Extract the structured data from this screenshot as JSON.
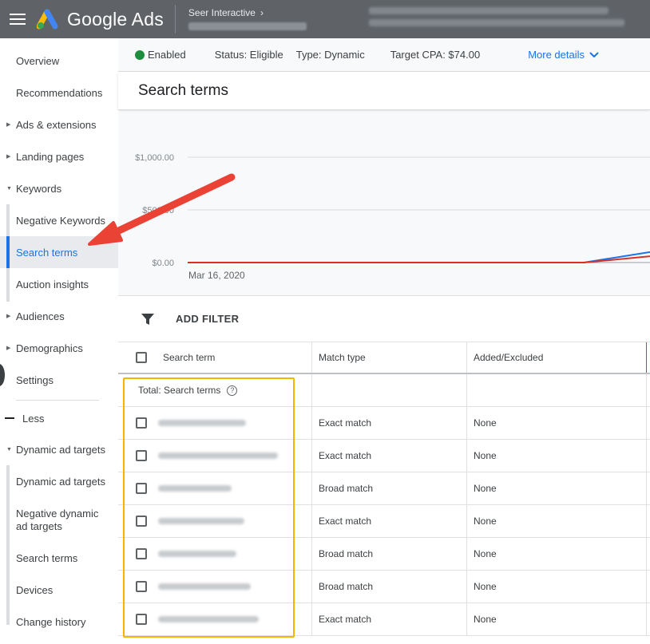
{
  "header": {
    "app_name": "Google Ads",
    "account_name": "Seer Interactive",
    "icons": [
      "menu-icon",
      "google-ads-logo",
      "chevron-right-icon"
    ]
  },
  "sidebar": {
    "items": [
      {
        "label": "Overview"
      },
      {
        "label": "Recommendations"
      },
      {
        "label": "Ads & extensions"
      },
      {
        "label": "Landing pages"
      },
      {
        "label": "Keywords"
      },
      {
        "label": "Negative Keywords"
      },
      {
        "label": "Search terms"
      },
      {
        "label": "Auction insights"
      },
      {
        "label": "Audiences"
      },
      {
        "label": "Demographics"
      },
      {
        "label": "Settings"
      },
      {
        "label": "Less"
      },
      {
        "label": "Dynamic ad targets"
      },
      {
        "label": "Dynamic ad targets"
      },
      {
        "label": "Negative dynamic ad targets"
      },
      {
        "label": "Search terms"
      },
      {
        "label": "Devices"
      },
      {
        "label": "Change history"
      }
    ]
  },
  "status_bar": {
    "enabled": "Enabled",
    "status": "Status: Eligible",
    "type": "Type: Dynamic",
    "target_cpa": "Target CPA: $74.00",
    "more_details": "More details"
  },
  "page": {
    "title": "Search terms"
  },
  "chart_data": {
    "type": "line",
    "y_ticks": [
      "$1,000.00",
      "$500.00",
      "$0.00"
    ],
    "x_ticks": [
      "Mar 16, 2020"
    ],
    "ylim": [
      0,
      1000
    ],
    "series": [
      {
        "color": "#1a73e8",
        "values": [
          0,
          0,
          0,
          0,
          0,
          0,
          0,
          100
        ]
      },
      {
        "color": "#d93025",
        "values": [
          0,
          0,
          0,
          0,
          0,
          0,
          0,
          60
        ]
      }
    ]
  },
  "filter": {
    "add_filter": "ADD FILTER"
  },
  "table": {
    "columns": [
      "Search term",
      "Match type",
      "Added/Excluded"
    ],
    "total_label": "Total: Search terms",
    "rows": [
      {
        "match": "Exact match",
        "added": "None"
      },
      {
        "match": "Exact match",
        "added": "None"
      },
      {
        "match": "Broad match",
        "added": "None"
      },
      {
        "match": "Exact match",
        "added": "None"
      },
      {
        "match": "Broad match",
        "added": "None"
      },
      {
        "match": "Broad match",
        "added": "None"
      },
      {
        "match": "Exact match",
        "added": "None"
      }
    ]
  },
  "colors": {
    "accent": "#1a73e8",
    "enabled": "#1e8e3e",
    "annotation_arrow": "#ea4335",
    "annotation_box": "#f4b400"
  }
}
